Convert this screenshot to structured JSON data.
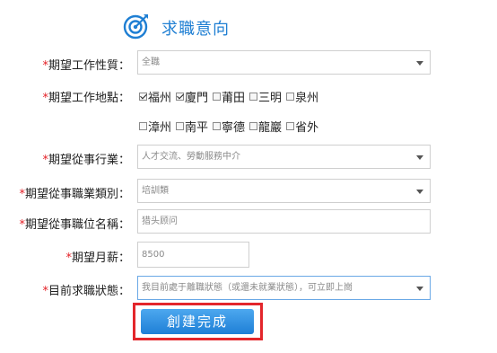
{
  "header": {
    "title": "求職意向",
    "icon": "target-icon",
    "accent_color": "#1f7fd3"
  },
  "required_mark": "*",
  "form": {
    "job_nature": {
      "label": "期望工作性質：",
      "value": "全職"
    },
    "work_location": {
      "label": "期望工作地點：",
      "options": [
        {
          "label": "福州",
          "checked": true
        },
        {
          "label": "廈門",
          "checked": true
        },
        {
          "label": "莆田",
          "checked": false
        },
        {
          "label": "三明",
          "checked": false
        },
        {
          "label": "泉州",
          "checked": false
        },
        {
          "label": "漳州",
          "checked": false
        },
        {
          "label": "南平",
          "checked": false
        },
        {
          "label": "寧德",
          "checked": false
        },
        {
          "label": "龍巖",
          "checked": false
        },
        {
          "label": "省外",
          "checked": false
        }
      ]
    },
    "industry": {
      "label": "期望從事行業：",
      "value": "人才交流、勞動服務中介"
    },
    "job_category": {
      "label": "期望從事職業類別：",
      "value": "培訓類"
    },
    "position_name": {
      "label": "期望從事職位名稱：",
      "value": "猎头顾问"
    },
    "salary": {
      "label": "期望月薪：",
      "value": "8500"
    },
    "job_status": {
      "label": "目前求職狀態：",
      "value": "我目前處于離職狀態（或還未就業狀態），可立即上崗"
    }
  },
  "submit_label": "創建完成",
  "colors": {
    "required": "#e31e24",
    "button": "#2a8be0",
    "highlight": "#e3262b"
  }
}
